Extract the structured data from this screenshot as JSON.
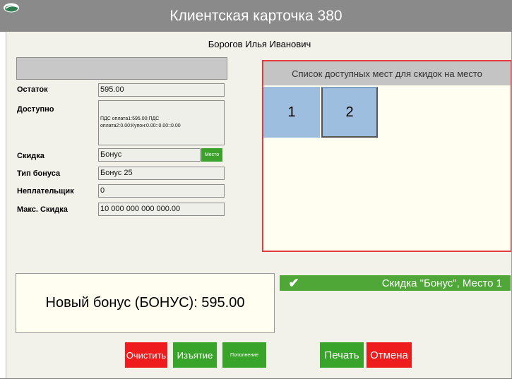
{
  "window": {
    "title": "Клиентская карточка 380",
    "logo_icon": "app-logo-icon"
  },
  "client": {
    "name": "Борогов Илья Иванович"
  },
  "fields": {
    "ostatok": {
      "label": "Остаток",
      "value": "595.00"
    },
    "dostupno": {
      "label": "Доступно",
      "value": "ПДС оплата1:595.00:ПДС оплата2:0.00:Купон:0.00::0.00::0.00"
    },
    "skidka": {
      "label": "Скидка",
      "value": "Бонус"
    },
    "tip_bonusa": {
      "label": "Тип бонуса",
      "value": "Бонус 25"
    },
    "neplatelshchik": {
      "label": "Неплательщик",
      "value": "0"
    },
    "maks_skidka": {
      "label": "Макс. Скидка",
      "value": "10 000 000 000 000.00"
    }
  },
  "mesto_button": "Место",
  "places": {
    "header": "Список доступных мест для скидок на место",
    "items": [
      "1",
      "2"
    ],
    "selected": "2"
  },
  "bonus": {
    "text": "Новый бонус (БОНУС): 595.00"
  },
  "status": {
    "text": "Скидка \"Бонус\", Место 1",
    "icon": "check-icon"
  },
  "buttons": {
    "clear": "Очистить",
    "withdraw": "Изъятие",
    "topup": "Пополнение",
    "print": "Печать",
    "cancel": "Отмена"
  },
  "colors": {
    "title_bar": "#8a8a8a",
    "panel": "#f2f1ea",
    "place_tile": "#9ebedf",
    "green": "#39a42a",
    "red": "#ee1c1c",
    "places_border": "#e43c3c"
  }
}
